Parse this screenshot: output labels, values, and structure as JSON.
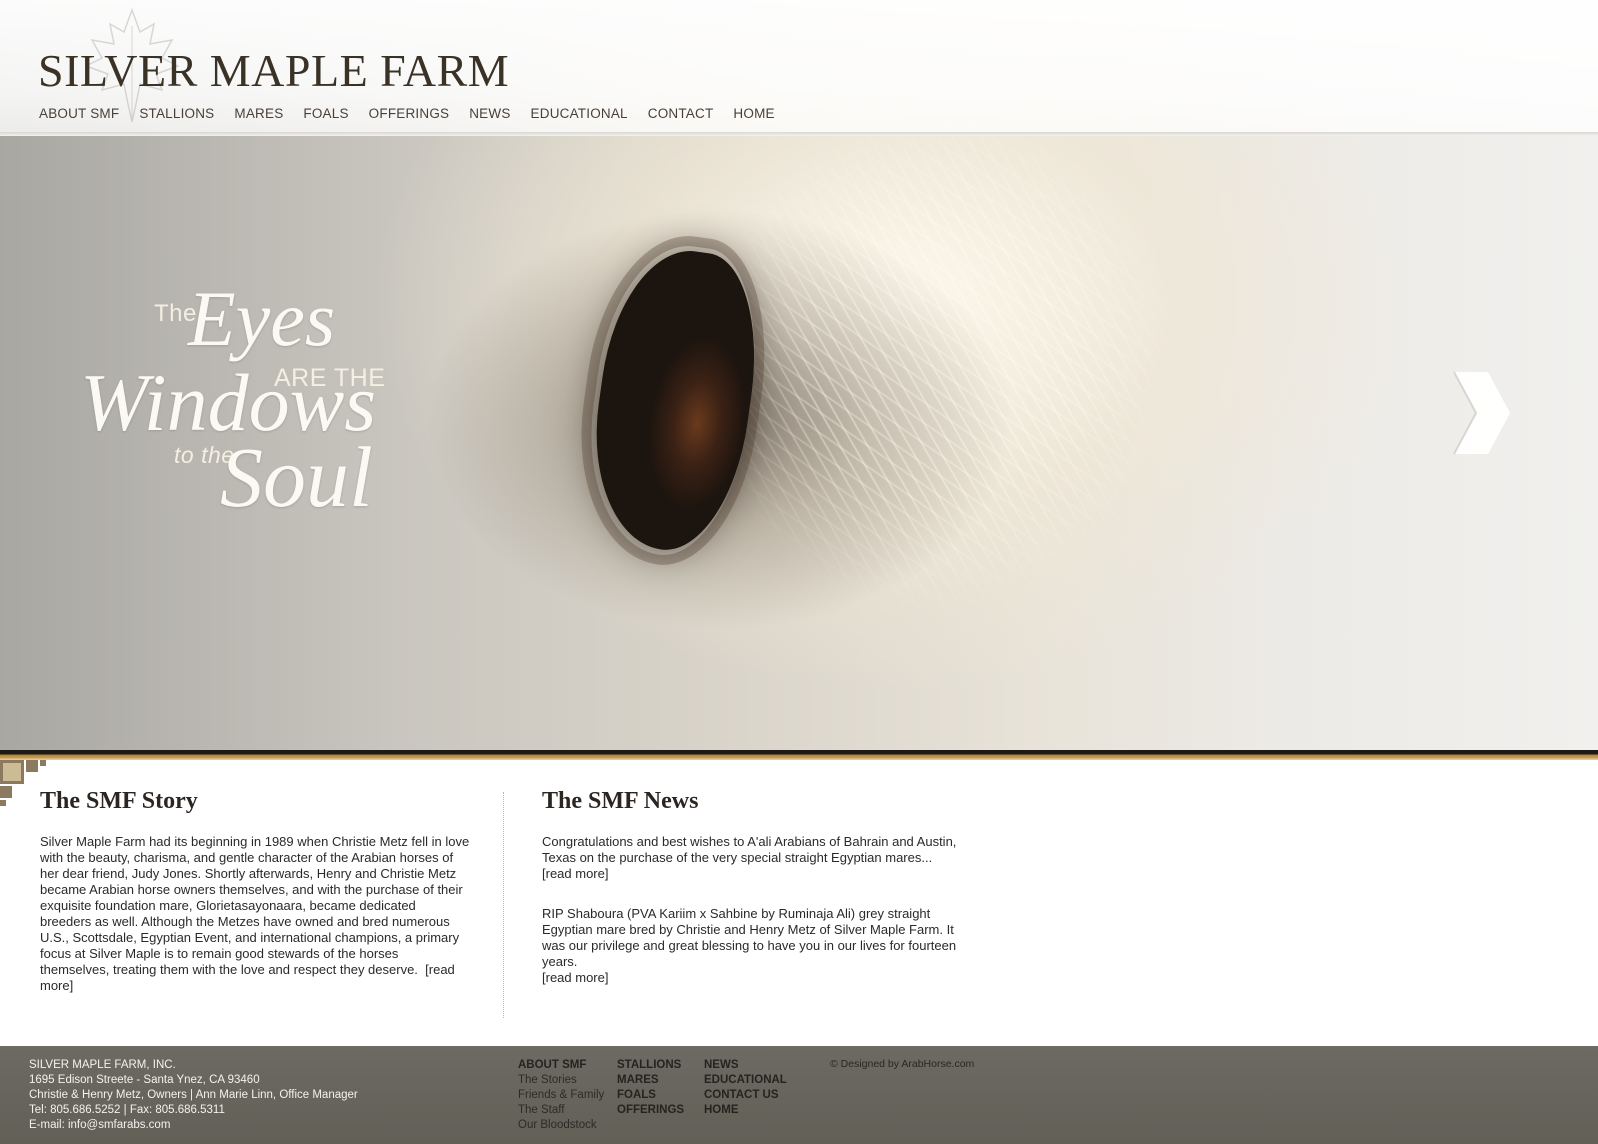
{
  "header": {
    "logo_text": "SILVER MAPLE FARM",
    "nav": [
      "ABOUT SMF",
      "STALLIONS",
      "MARES",
      "FOALS",
      "OFFERINGS",
      "NEWS",
      "EDUCATIONAL",
      "CONTACT",
      "HOME"
    ]
  },
  "hero": {
    "tagline": {
      "the": "The",
      "eyes": "Eyes",
      "are_the": "ARE THE",
      "windows": "Windows",
      "to_the": "to the",
      "soul": "Soul"
    },
    "next_icon": "chevron-right-icon"
  },
  "story": {
    "title": "The SMF Story",
    "text": "Silver Maple Farm had its beginning in 1989 when Christie Metz fell in love with the beauty, charisma, and gentle character of the Arabian horses of her dear friend, Judy Jones. Shortly afterwards, Henry and Christie Metz became Arabian horse owners themselves, and with the purchase of their exquisite foundation mare, Glorietasayonaara, became dedicated breeders as well. Although the Metzes have owned and bred numerous U.S., Scottsdale, Egyptian Event, and international champions, a primary focus at Silver Maple is to remain good stewards of the horses themselves, treating them with the love and respect they deserve.",
    "read_more": "[read more]"
  },
  "news": {
    "title": "The SMF News",
    "items": [
      {
        "text": "Congratulations and best wishes to A'ali Arabians of Bahrain and Austin, Texas on the purchase of the very special straight Egyptian mares...",
        "read_more": "[read more]"
      },
      {
        "text": "RIP Shaboura (PVA Kariim x Sahbine by Ruminaja Ali) grey straight Egyptian mare bred by Christie and Henry Metz of Silver Maple Farm. It was our privilege and great blessing to have you in our lives for fourteen years.",
        "read_more": "[read more]"
      }
    ]
  },
  "footer": {
    "address": [
      "SILVER MAPLE FARM, INC.",
      "1695 Edison Streete - Santa Ynez, CA 93460",
      "Christie & Henry Metz, Owners | Ann Marie Linn, Office Manager",
      "Tel: 805.686.5252 | Fax: 805.686.5311",
      "E-mail: info@smfarabs.com"
    ],
    "col1": {
      "head": "ABOUT SMF",
      "links": [
        "The Stories",
        "Friends & Family",
        "The Staff",
        "Our Bloodstock"
      ]
    },
    "col2": {
      "links": [
        "STALLIONS",
        "MARES",
        "FOALS",
        "OFFERINGS"
      ]
    },
    "col3": {
      "links": [
        "NEWS",
        "EDUCATIONAL",
        "CONTACT US",
        "HOME"
      ]
    },
    "credit": "© Designed by ArabHorse.com"
  },
  "colors": {
    "footer_bg": "#666359",
    "accent_gold": "#c79a4a",
    "logo_text": "#3a3226"
  }
}
